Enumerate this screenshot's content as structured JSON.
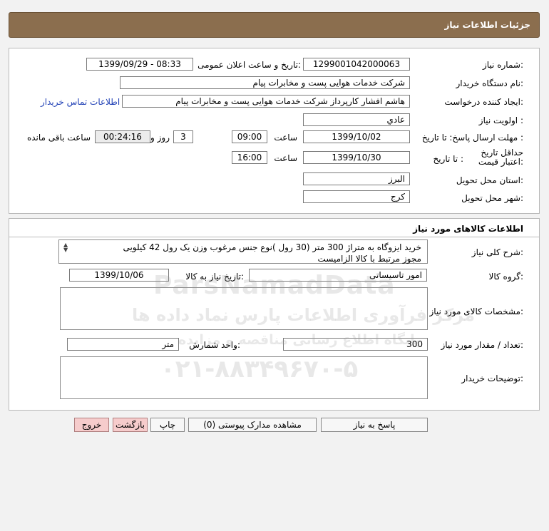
{
  "header": {
    "title": "جزئیات اطلاعات نیاز"
  },
  "info": {
    "need_number_label": "شماره نیاز:",
    "need_number": "1299001042000063",
    "announce_label": "تاریخ و ساعت اعلان عمومی:",
    "announce_value": "1399/09/29 - 08:33",
    "buyer_org_label": "نام دستگاه خریدار:",
    "buyer_org": "شرکت خدمات هوایی پست و مخابرات پیام",
    "requester_label": "ایجاد کننده درخواست:",
    "requester": "هاشم افشار کارپرداز شرکت خدمات هوایی پست و مخابرات پیام",
    "contact_link": "اطلاعات تماس خریدار",
    "priority_label": "اولویت نیاز :",
    "priority": "عادي",
    "deadline_label": "مهلت ارسال پاسخ:",
    "to_date_label": "تا تاریخ :",
    "deadline_date": "1399/10/02",
    "time_label": "ساعت",
    "deadline_time": "09:00",
    "days": "3",
    "days_label": "روز و",
    "remaining": "00:24:16",
    "remaining_label": "ساعت باقی مانده",
    "validity_label": "حداقل تاریخ اعتبار قیمت:",
    "validity_to_label": "تا تاریخ :",
    "validity_date": "1399/10/30",
    "validity_time_label": "ساعت",
    "validity_time": "16:00",
    "province_label": "استان محل تحویل:",
    "province": "البرز",
    "city_label": "شهر محل تحویل:",
    "city": "کرج"
  },
  "goods": {
    "section_title": "اطلاعات کالاهای مورد نیاز",
    "desc_label": "شرح کلی نیاز:",
    "desc_line1": "خرید ایزوگاه به متراژ 300 متر (30 رول )نوع جنس مرغوب وزن یک رول 42 کیلویی",
    "desc_line2": "مجوز مرتبط با کالا الزامیست",
    "group_label": "گروه کالا:",
    "group": "امور تاسیساتی",
    "need_date_label": "تاریخ نیاز به کالا:",
    "need_date": "1399/10/06",
    "specs_label": "مشخصات کالای مورد نیاز:",
    "qty_label": "تعداد / مقدار مورد نیاز:",
    "qty": "300",
    "unit_label": "واحد شمارش:",
    "unit": "متر",
    "buyer_notes_label": "توضیحات خریدار:"
  },
  "buttons": {
    "reply": "پاسخ به نیاز",
    "attachments": "مشاهده مدارک پیوستی (0)",
    "print": "چاپ",
    "back": "بازگشت",
    "exit": "خروج"
  },
  "watermark": {
    "brand": "ParsNamadData",
    "line1": "مرکز فرآوری اطلاعات پارس نماد داده ها",
    "line2": "پایگاه اطلاع رسانی مناقصه و مزایده",
    "phone": "۰۲۱-۸۸۳۴۹۶۷۰-۵"
  }
}
